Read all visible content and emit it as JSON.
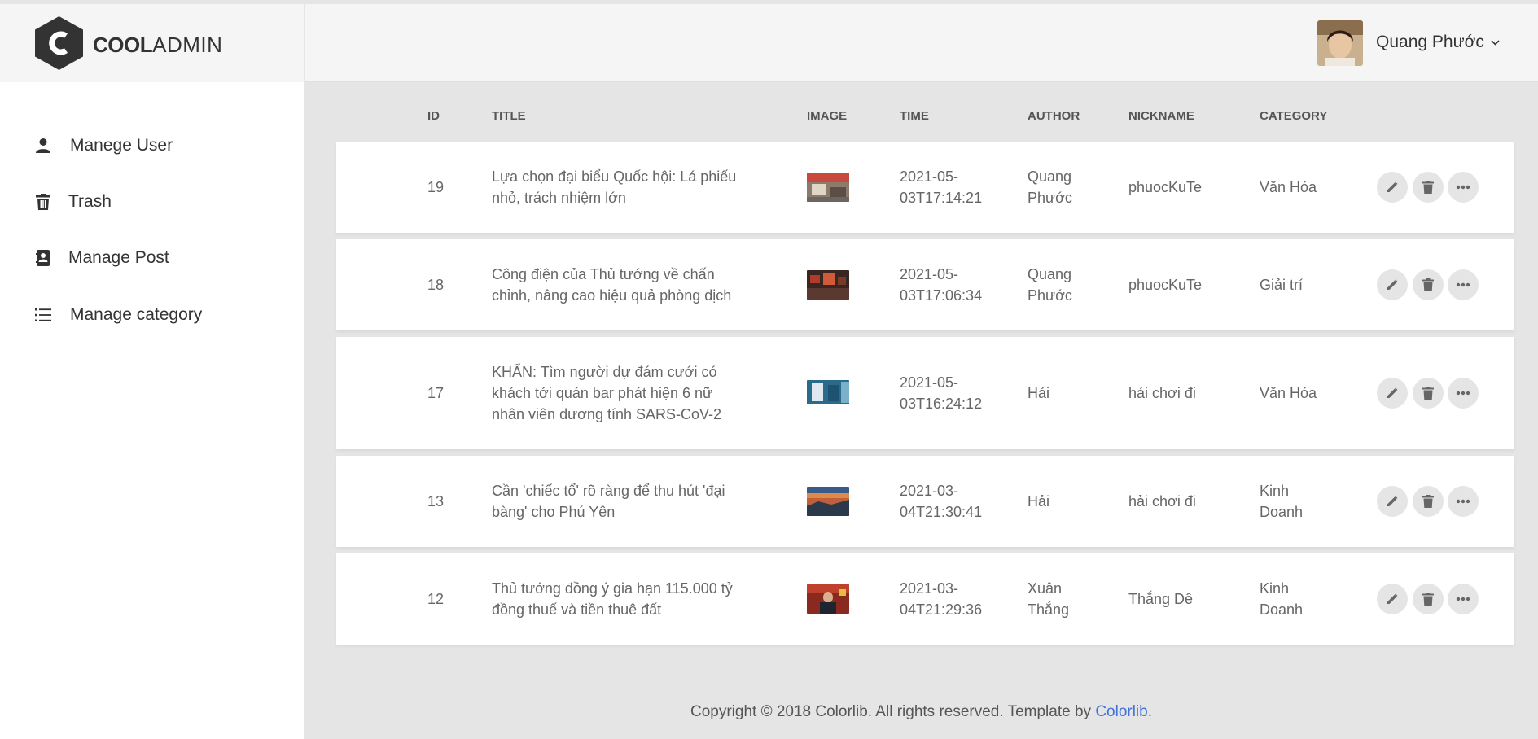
{
  "brand": {
    "bold": "COOL",
    "light": "ADMIN"
  },
  "user": {
    "name": "Quang Phước"
  },
  "sidebar": {
    "items": [
      {
        "label": "Manege User",
        "icon": "user-icon"
      },
      {
        "label": "Trash",
        "icon": "trash-icon"
      },
      {
        "label": "Manage Post",
        "icon": "contact-book-icon"
      },
      {
        "label": "Manage category",
        "icon": "list-icon"
      }
    ]
  },
  "table": {
    "headers": [
      "ID",
      "TITLE",
      "IMAGE",
      "TIME",
      "AUTHOR",
      "NICKNAME",
      "CATEGORY"
    ],
    "rows": [
      {
        "id": "19",
        "title_l1": "Lựa chọn đại biểu Quốc hội: Lá phiếu",
        "title_l2": "nhỏ, trách nhiệm lớn",
        "title_l3": "",
        "time_l1": "2021-05-",
        "time_l2": "03T17:14:21",
        "author_l1": "Quang",
        "author_l2": "Phước",
        "nickname": "phuocKuTe",
        "category_l1": "Văn Hóa",
        "category_l2": ""
      },
      {
        "id": "18",
        "title_l1": "Công điện của Thủ tướng về chấn",
        "title_l2": "chỉnh, nâng cao hiệu quả phòng dịch",
        "title_l3": "",
        "time_l1": "2021-05-",
        "time_l2": "03T17:06:34",
        "author_l1": "Quang",
        "author_l2": "Phước",
        "nickname": "phuocKuTe",
        "category_l1": "Giải trí",
        "category_l2": ""
      },
      {
        "id": "17",
        "title_l1": "KHẨN: Tìm người dự đám cưới có",
        "title_l2": "khách tới quán bar phát hiện 6 nữ",
        "title_l3": "nhân viên dương tính SARS-CoV-2",
        "time_l1": "2021-05-",
        "time_l2": "03T16:24:12",
        "author_l1": "Hải",
        "author_l2": "",
        "nickname": "hải chơi đi",
        "category_l1": "Văn Hóa",
        "category_l2": ""
      },
      {
        "id": "13",
        "title_l1": "Cần 'chiếc tổ' rõ ràng để thu hút 'đại",
        "title_l2": "bàng' cho Phú Yên",
        "title_l3": "",
        "time_l1": "2021-03-",
        "time_l2": "04T21:30:41",
        "author_l1": "Hải",
        "author_l2": "",
        "nickname": "hải chơi đi",
        "category_l1": "Kinh",
        "category_l2": "Doanh"
      },
      {
        "id": "12",
        "title_l1": "Thủ tướng đồng ý gia hạn 115.000 tỷ",
        "title_l2": "đồng thuế và tiền thuê đất",
        "title_l3": "",
        "time_l1": "2021-03-",
        "time_l2": "04T21:29:36",
        "author_l1": "Xuân",
        "author_l2": "Thắng",
        "nickname": "Thắng Dê",
        "category_l1": "Kinh",
        "category_l2": "Doanh"
      }
    ]
  },
  "footer": {
    "text": "Copyright © 2018 Colorlib. All rights reserved. Template by ",
    "link": "Colorlib",
    "tail": "."
  },
  "colors": {
    "accent": "#4272d7",
    "content_bg": "#e5e5e5",
    "action_bg": "#e5e5e5"
  }
}
